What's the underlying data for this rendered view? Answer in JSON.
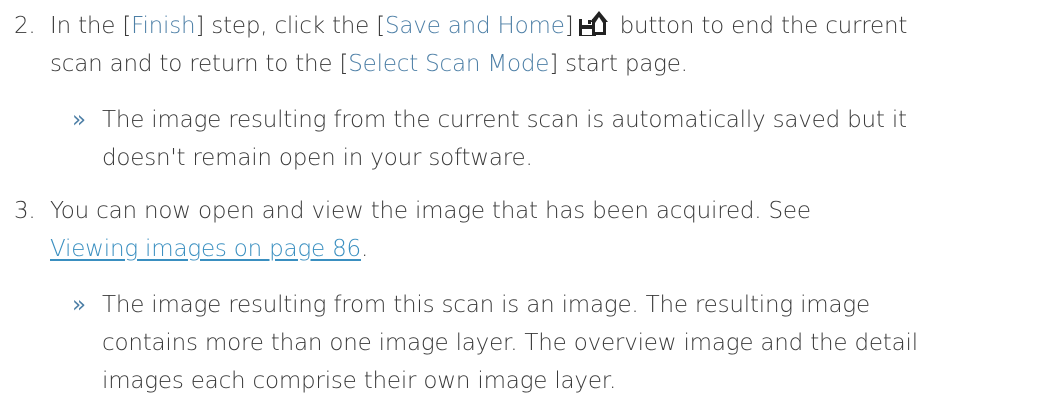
{
  "steps": [
    {
      "number": "2.",
      "text_1": "In the ",
      "term_finish": "Finish",
      "text_2": " step, click the ",
      "term_save_home": "Save and Home",
      "text_3": " button to end the current",
      "line_2_text_1": "scan and to return to the ",
      "term_select_scan_mode": "Select Scan Mode",
      "line_2_text_2": " start page.",
      "result_marker": "»",
      "result_line_1": "The image resulting from the current scan is automatically saved but it",
      "result_line_2": "doesn't remain open in your software."
    },
    {
      "number": "3.",
      "line_1": "You can now open and view the image that has been acquired. See",
      "link_text": "Viewing images on page 86",
      "line_2_after_link": ".",
      "result_marker": "»",
      "result_line_1": "The image resulting from this scan is an image. The resulting image",
      "result_line_2": "contains more than one image layer. The overview image and the detail",
      "result_line_3": "images each comprise their own image layer."
    }
  ],
  "icons": {
    "save_home": "save-and-home-icon"
  },
  "colors": {
    "text": "#3a3a3a",
    "ui_term": "#4d7fa6",
    "link": "#3a8fc0",
    "icon": "#222222"
  }
}
